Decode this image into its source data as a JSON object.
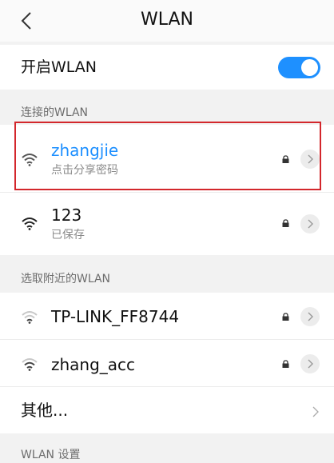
{
  "header": {
    "title": "WLAN"
  },
  "wlan_toggle": {
    "label": "开启WLAN",
    "enabled": true
  },
  "connected_section": {
    "label": "连接的WLAN"
  },
  "saved_networks": [
    {
      "name": "zhangjie",
      "status": "点击分享密码",
      "locked": true,
      "connected": true,
      "highlight": true
    },
    {
      "name": "123",
      "status": "已保存",
      "locked": true,
      "connected": false
    }
  ],
  "nearby_section": {
    "label": "选取附近的WLAN"
  },
  "nearby_networks": [
    {
      "name": "TP-LINK_FF8744",
      "locked": true
    },
    {
      "name": "zhang_acc",
      "locked": true
    }
  ],
  "other": {
    "label": "其他..."
  },
  "settings_section": {
    "label": "WLAN 设置"
  },
  "colors": {
    "accent": "#1e90ff",
    "highlight_border": "#d3272c",
    "background": "#f2f2f2"
  },
  "icons": {
    "back": "chevron-left-icon",
    "wifi": "wifi-signal-icon",
    "lock": "lock-icon",
    "detail": "chevron-right-icon"
  }
}
